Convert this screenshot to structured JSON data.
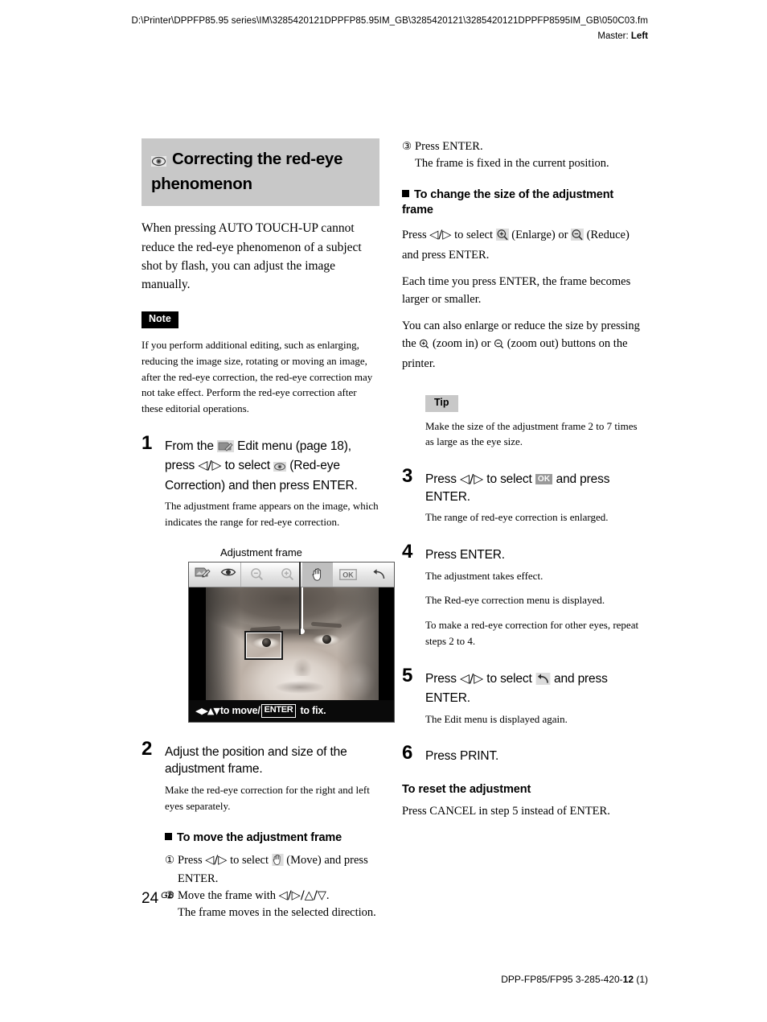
{
  "header": {
    "path": "D:\\Printer\\DPPFP85.95 series\\IM\\3285420121DPPFP85.95IM_GB\\3285420121\\3285420121DPPFP8595IM_GB\\050C03.fm",
    "master_label": "Master: ",
    "master_value": "Left"
  },
  "section": {
    "title": "Correcting the red-eye phenomenon",
    "icon": "eye-icon"
  },
  "intro": "When pressing AUTO TOUCH-UP cannot reduce the red-eye phenomenon of a subject shot by flash, you can adjust the image manually.",
  "note": {
    "badge": "Note",
    "text": "If you perform additional editing, such as enlarging, reducing the image size, rotating or moving an image, after the red-eye correction, the red-eye correction may not take effect. Perform the red-eye correction after these editorial operations."
  },
  "steps": {
    "one": {
      "num": "1",
      "lead_a": "From the",
      "lead_b": "Edit menu (page 18), press",
      "arrows": "◁/▷",
      "lead_c": "to select",
      "lead_d": "(Red-eye Correction) and then press ENTER.",
      "detail": "The adjustment frame appears on the image, which indicates the range for red-eye correction."
    },
    "two": {
      "num": "2",
      "lead": "Adjust the position and size of the adjustment frame.",
      "detail": "Make the red-eye correction for the right and left eyes separately."
    },
    "three": {
      "num": "3",
      "lead_a": "Press",
      "arrows": "◁/▷",
      "lead_b": "to select",
      "ok_chip": "OK",
      "lead_c": "and press ENTER.",
      "detail": "The range of red-eye correction is enlarged."
    },
    "four": {
      "num": "4",
      "lead": "Press ENTER.",
      "detail_1": "The adjustment takes effect.",
      "detail_2": "The Red-eye correction menu is displayed.",
      "detail_3": "To make a red-eye correction for other eyes, repeat steps 2 to 4."
    },
    "five": {
      "num": "5",
      "lead_a": "Press",
      "arrows": "◁/▷",
      "lead_b": "to select",
      "lead_c": "and press ENTER.",
      "detail": "The Edit menu is displayed again."
    },
    "six": {
      "num": "6",
      "lead": "Press PRINT."
    }
  },
  "figure": {
    "caption": "Adjustment frame",
    "status_arrows": "◀▶▲▼",
    "status_text_a": "to move/",
    "status_chip": "ENTER",
    "status_text_b": "to fix.",
    "toolbar_icons": [
      "edit-menu-icon",
      "red-eye-icon",
      "zoom-out-icon",
      "zoom-in-icon",
      "move-hand-icon",
      "ok-icon",
      "undo-icon"
    ],
    "selected_tool": "move-hand-icon"
  },
  "move_frame": {
    "heading": "To move the adjustment frame",
    "item1_num": "①",
    "item1_a": "Press",
    "item1_arrows": "◁/▷",
    "item1_b": "to select",
    "item1_c": "(Move) and press ENTER.",
    "item2_num": "②",
    "item2_a": "Move the frame with",
    "item2_arrows": "◁/▷/△/▽",
    "item2_b": ".",
    "item2_detail": "The frame moves in the selected direction."
  },
  "right_column": {
    "item3_num": "③",
    "item3_lead": "Press ENTER.",
    "item3_detail": "The frame is fixed in the current position.",
    "resize_heading": "To change the size of the adjustment frame",
    "resize_a": "Press",
    "resize_arrows": "◁/▷",
    "resize_b": "to select",
    "resize_c": "(Enlarge) or",
    "resize_d": "(Reduce) and press ENTER.",
    "resize_p2": "Each time you press ENTER, the frame becomes larger or smaller.",
    "resize_p3_a": "You can also enlarge or reduce the size by pressing the",
    "resize_p3_b": "(zoom in) or",
    "resize_p3_c": "(zoom out) buttons on the printer.",
    "tip_badge": "Tip",
    "tip_text": "Make the size of the adjustment frame 2 to 7 times as large as the eye size.",
    "reset_heading": "To reset the adjustment",
    "reset_text": "Press CANCEL in step 5 instead of ENTER."
  },
  "footer": {
    "page_number": "24",
    "page_suffix": "GB",
    "model_a": "DPP-FP85/FP95 3-285-420-",
    "model_bold": "12",
    "model_b": " (1)"
  },
  "colors": {
    "title_bg": "#c8c8c8",
    "note_bg": "#000000",
    "tip_bg": "#c8c8c8",
    "ok_chip": "#9a9a9a"
  }
}
